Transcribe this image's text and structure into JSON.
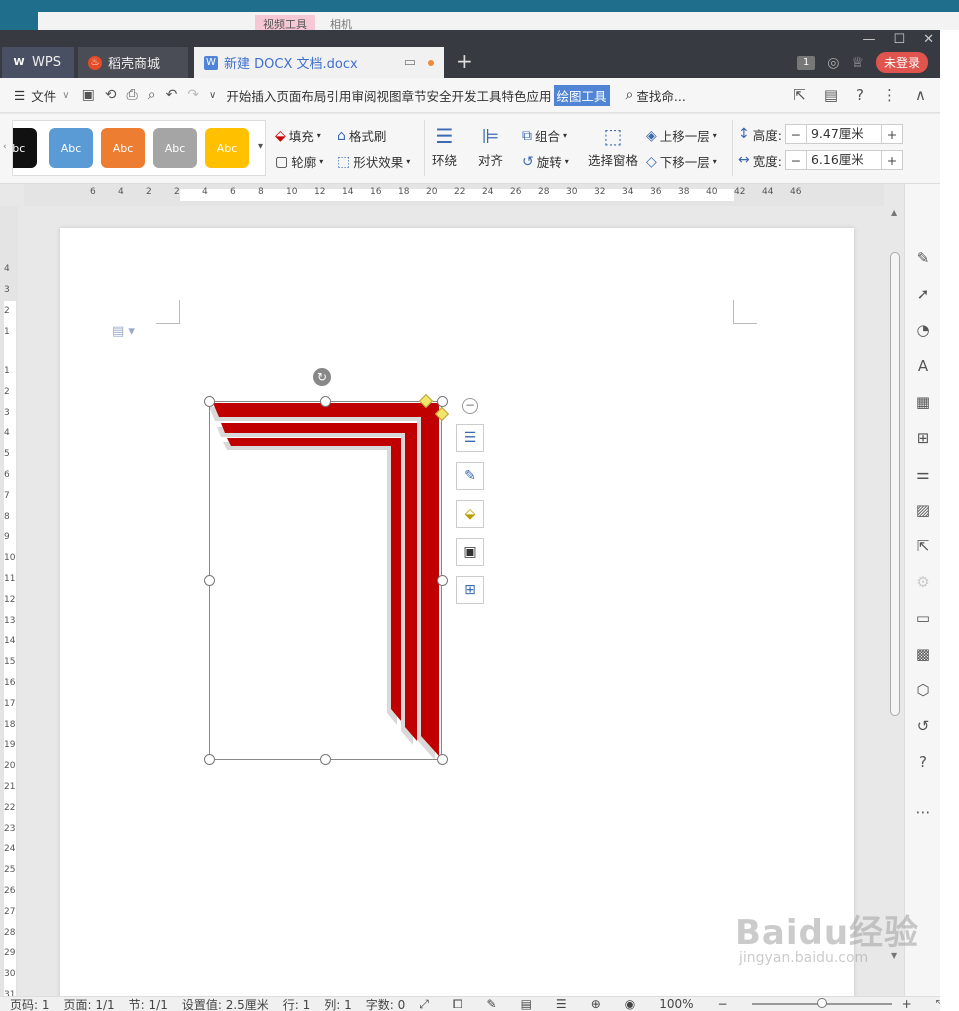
{
  "background": {
    "tab_active": "视频工具",
    "tab_other": "相机"
  },
  "titlebar": {
    "tabs": [
      {
        "label": "WPS"
      },
      {
        "label": "稻壳商城"
      },
      {
        "label": "新建 DOCX 文档.docx"
      }
    ],
    "login": "未登录",
    "badge": "1"
  },
  "menu": {
    "file": "文件",
    "items": [
      "开始",
      "插入",
      "页面布局",
      "引用",
      "审阅",
      "视图",
      "章节",
      "安全",
      "开发工具",
      "特色应用"
    ],
    "active": "绘图工具",
    "search": "查找命..."
  },
  "ribbon": {
    "style_label": "Abc",
    "styles": [
      {
        "color": "#111111"
      },
      {
        "color": "#5b9bd5"
      },
      {
        "color": "#ed7d31"
      },
      {
        "color": "#a5a5a5"
      },
      {
        "color": "#ffc000"
      }
    ],
    "fill": "填充",
    "format_painter": "格式刷",
    "outline": "轮廓",
    "shape_effect": "形状效果",
    "wrap": "环绕",
    "align": "对齐",
    "group": "组合",
    "rotate": "旋转",
    "selection_pane": "选择窗格",
    "bring_forward": "上移一层",
    "send_backward": "下移一层",
    "height_label": "高度:",
    "height_value": "9.47厘米",
    "width_label": "宽度:",
    "width_value": "6.16厘米"
  },
  "ruler": {
    "h": [
      "6",
      "4",
      "2",
      "2",
      "4",
      "6",
      "8",
      "10",
      "12",
      "14",
      "16",
      "18",
      "20",
      "22",
      "24",
      "26",
      "28",
      "30",
      "32",
      "34",
      "36",
      "38",
      "40",
      "42",
      "44",
      "46"
    ],
    "v_top": [
      "4",
      "3",
      "2",
      "1"
    ],
    "v": [
      "1",
      "2",
      "3",
      "4",
      "5",
      "6",
      "7",
      "8",
      "9",
      "10",
      "11",
      "12",
      "13",
      "14",
      "15",
      "16",
      "17",
      "18",
      "19",
      "20",
      "21",
      "22",
      "23",
      "24",
      "25",
      "26",
      "27",
      "28",
      "29",
      "30",
      "31"
    ]
  },
  "shape": {
    "fill": "#c00000",
    "shadow": "#d9d9d9"
  },
  "status": {
    "page_no": "页码: 1",
    "pages": "页面: 1/1",
    "section": "节: 1/1",
    "setting": "设置值: 2.5厘米",
    "row": "行: 1",
    "col": "列: 1",
    "words": "字数: 0",
    "zoom": "100%",
    "zoom_level": 0.5
  },
  "watermark": {
    "main": "Baidu经验",
    "sub": "jingyan.baidu.com"
  }
}
